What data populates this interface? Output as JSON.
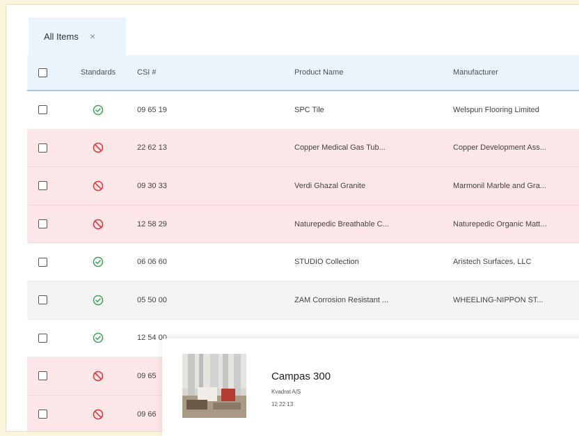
{
  "tabs": [
    {
      "label": "All Items",
      "close": "×"
    }
  ],
  "table": {
    "columns": {
      "standards": "Standards",
      "csi": "CSI #",
      "product_name": "Product Name",
      "manufacturer": "Manufacturer"
    },
    "rows": [
      {
        "status": "ok",
        "csi": "09 65 19",
        "product_name": "SPC Tile",
        "manufacturer": "Welspun Flooring Limited"
      },
      {
        "status": "bad",
        "csi": "22 62 13",
        "product_name": "Copper Medical Gas Tub...",
        "manufacturer": "Copper Development Ass..."
      },
      {
        "status": "bad",
        "csi": "09 30 33",
        "product_name": "Verdi Ghazal Granite",
        "manufacturer": "Marmonil Marble and Gra..."
      },
      {
        "status": "bad",
        "csi": "12 58 29",
        "product_name": "Naturepedic Breathable C...",
        "manufacturer": "Naturepedic Organic Matt..."
      },
      {
        "status": "ok",
        "csi": "06 06 60",
        "product_name": "STUDIO Collection",
        "manufacturer": "Aristech Surfaces, LLC"
      },
      {
        "status": "ok",
        "csi": "05 50 00",
        "product_name": "ZAM Corrosion Resistant ...",
        "manufacturer": "WHEELING-NIPPON ST..."
      },
      {
        "status": "ok",
        "csi": "12 54 00",
        "product_name": "",
        "manufacturer": ""
      },
      {
        "status": "bad",
        "csi": "09 65",
        "product_name": "",
        "manufacturer": ""
      },
      {
        "status": "bad",
        "csi": "09 66",
        "product_name": "",
        "manufacturer": ""
      }
    ]
  },
  "popup": {
    "title": "Campas 300",
    "manufacturer": "Kvadrat A/S",
    "csi": "12 22 13"
  },
  "colors": {
    "ok_icon": "#3aa35a",
    "bad_icon": "#d9363e",
    "bad_row": "#fde6e7",
    "header_bg": "#eaf4fc"
  },
  "icons": {
    "ok": "check-circle-icon",
    "bad": "prohibited-icon"
  }
}
